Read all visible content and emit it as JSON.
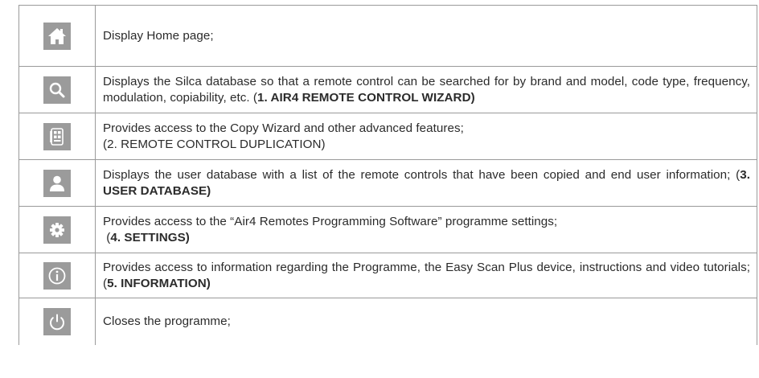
{
  "rows": [
    {
      "icon": "home-icon",
      "segments": [
        {
          "text": "Display Home page;",
          "bold": false
        }
      ]
    },
    {
      "icon": "search-icon",
      "segments": [
        {
          "text": "Displays the Silca database so that a remote control can be searched for by brand and model, code type, frequency, modulation, copiability, etc.  (",
          "bold": false
        },
        {
          "text": "1. AIR4 REMOTE CONTROL WIZARD)",
          "bold": true
        }
      ]
    },
    {
      "icon": "remote-control-icon",
      "segments": [
        {
          "text": "Provides access to the Copy Wizard and other advanced features;",
          "bold": false
        },
        {
          "text": "(2. REMOTE CONTROL DUPLICATION)",
          "bold": false
        }
      ]
    },
    {
      "icon": "user-icon",
      "segments": [
        {
          "text": "Displays the user database with a list of the remote controls that have been copied and end user information; (",
          "bold": false
        },
        {
          "text": "3. USER DATABASE)",
          "bold": true
        }
      ]
    },
    {
      "icon": "gear-icon",
      "segments": [
        {
          "text": "Provides access to the “Air4 Remotes Programming Software” programme settings;",
          "bold": false
        },
        {
          "text": " (",
          "bold": false
        },
        {
          "text": "4. SETTINGS)",
          "bold": true
        }
      ]
    },
    {
      "icon": "info-icon",
      "segments": [
        {
          "text": "Provides access to information regarding the Programme, the Easy Scan Plus device, instructions and video tutorials; (",
          "bold": false
        },
        {
          "text": "5. INFORMATION)",
          "bold": true
        }
      ]
    },
    {
      "icon": "power-icon",
      "segments": [
        {
          "text": "Closes the programme;",
          "bold": false
        }
      ]
    }
  ],
  "colors": {
    "icon_background": "#9b9b9b",
    "icon_foreground": "#ffffff",
    "border": "#9a9a9a",
    "text": "#2b2b2b"
  }
}
